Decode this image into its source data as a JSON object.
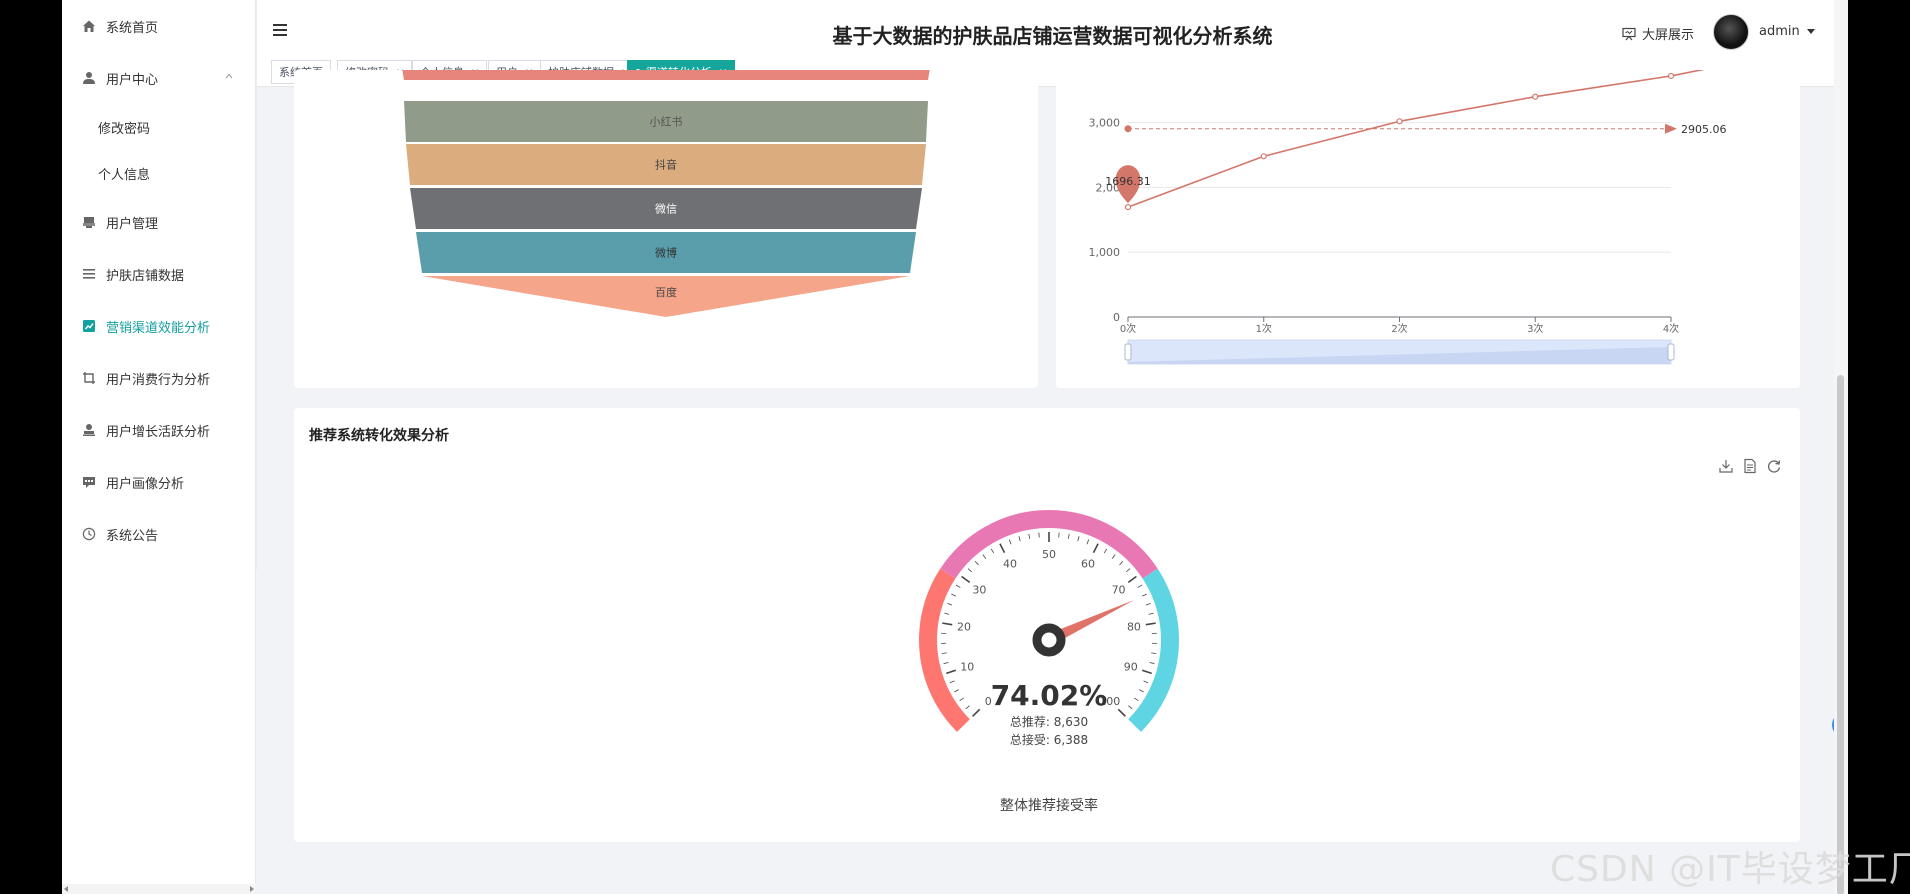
{
  "sidebar": {
    "items": [
      {
        "label": "系统首页"
      },
      {
        "label": "用户中心"
      },
      {
        "label": "修改密码"
      },
      {
        "label": "个人信息"
      },
      {
        "label": "用户管理"
      },
      {
        "label": "护肤店铺数据"
      },
      {
        "label": "营销渠道效能分析"
      },
      {
        "label": "用户消费行为分析"
      },
      {
        "label": "用户增长活跃分析"
      },
      {
        "label": "用户画像分析"
      },
      {
        "label": "系统公告"
      }
    ]
  },
  "header": {
    "title": "基于大数据的护肤品店铺运营数据可视化分析系统",
    "bigscreen_label": "大屏展示",
    "username": "admin"
  },
  "tabs": [
    {
      "label": "系统首页"
    },
    {
      "label": "修改密码",
      "close": "×"
    },
    {
      "label": "个人信息",
      "close": "×"
    },
    {
      "label": "用户",
      "close": "×"
    },
    {
      "label": "护肤店铺数据",
      "close": "×"
    },
    {
      "label": "渠道转化分析",
      "close": "×"
    }
  ],
  "colors": {
    "accent": "#14a59b",
    "funnel_red": "#e6857b",
    "funnel_xhs": "#919b8a",
    "funnel_dy": "#daac7e",
    "funnel_wx": "#6e7074",
    "funnel_wb": "#5a9dab",
    "funnel_bd": "#f5a68a",
    "line": "#d4776b",
    "gauge_red": "#fd7670",
    "gauge_pink": "#e878b4",
    "gauge_cyan": "#5fd4e3"
  },
  "funnel": {
    "labels": [
      "小红书",
      "抖音",
      "微信",
      "微博",
      "百度"
    ]
  },
  "chart_data": [
    {
      "type": "line",
      "x": [
        "0次",
        "1次",
        "2次",
        "3次",
        "4次"
      ],
      "y_ticks": [
        "0",
        "1,000",
        "2,00",
        "3,000"
      ],
      "series": [
        {
          "values": [
            1696.31,
            2480,
            3020,
            3400,
            3720
          ]
        }
      ],
      "markline_value": "2905.06",
      "markpoint_value": "1696.31",
      "ylim": [
        0,
        3500
      ]
    },
    {
      "type": "gauge",
      "title": "推荐系统转化效果分析",
      "value": 74.02,
      "value_text": "74.02%",
      "min": 0,
      "max": 100,
      "tick_labels": [
        "0",
        "10",
        "20",
        "30",
        "40",
        "50",
        "60",
        "70",
        "80",
        "90",
        "100"
      ],
      "detail_lines": [
        "总推荐: 8,630",
        "总接受: 6,388"
      ],
      "name": "整体推荐接受率"
    }
  ],
  "watermark": "CSDN @IT毕设梦工厂"
}
